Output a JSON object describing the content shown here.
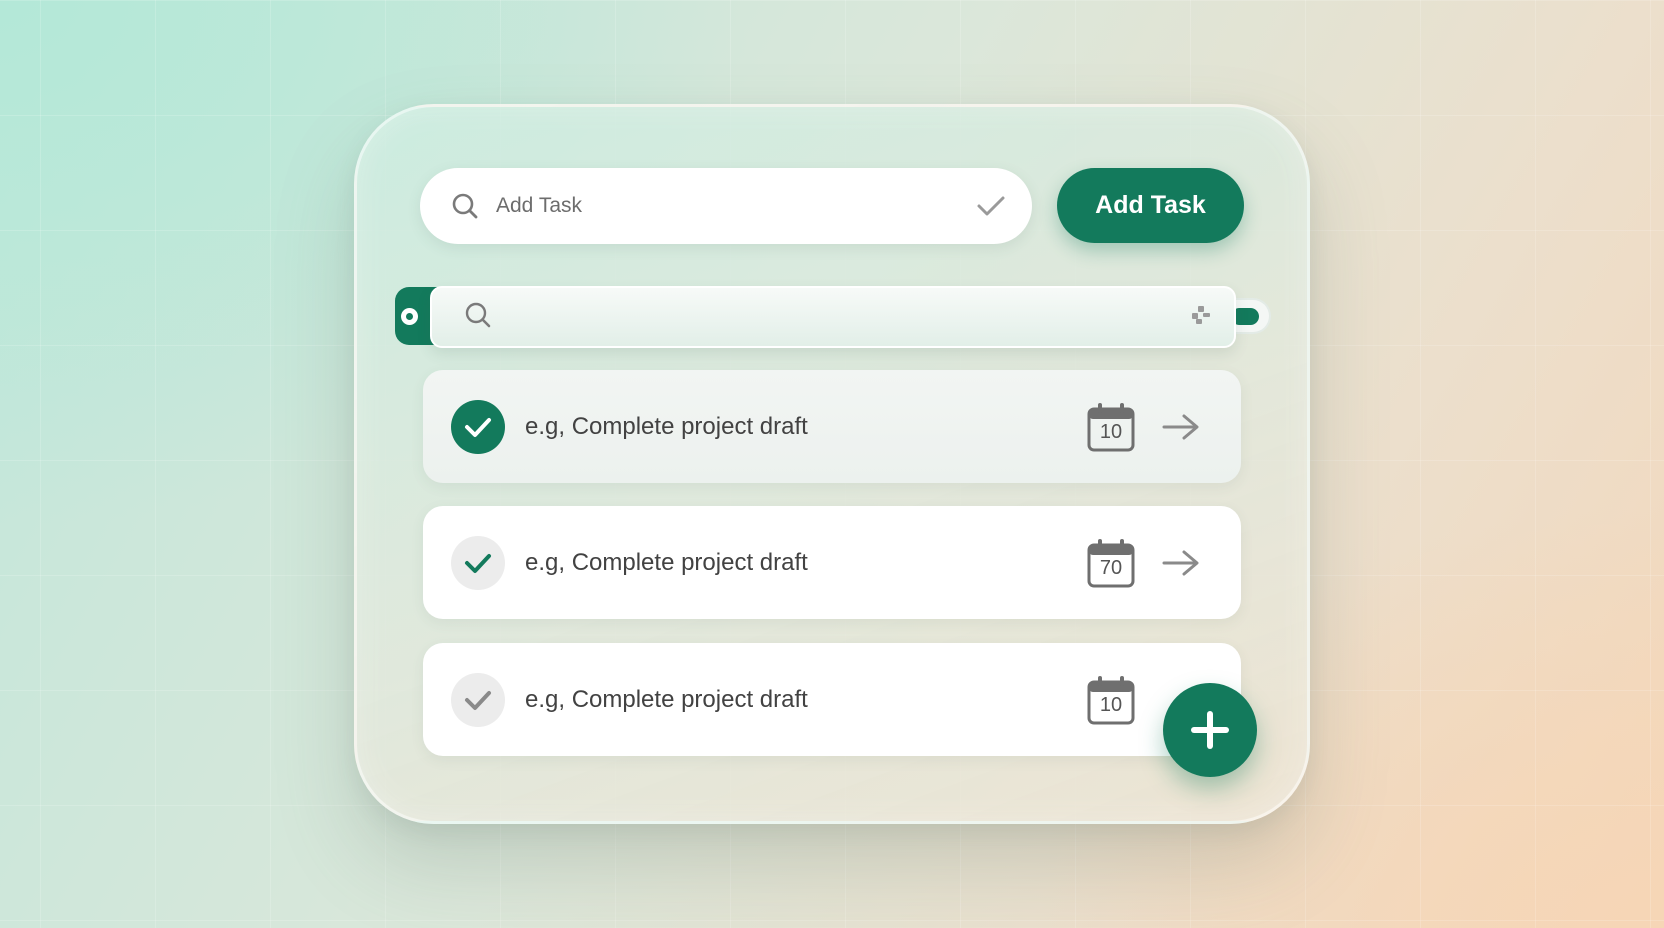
{
  "add_task": {
    "input_placeholder": "Add Task",
    "button_label": "Add Task"
  },
  "search": {
    "placeholder": ""
  },
  "tasks": [
    {
      "label": "e.g, Complete project draft",
      "date": "10",
      "state": "completed-primary"
    },
    {
      "label": "e.g, Complete project draft",
      "date": "70",
      "state": "completed"
    },
    {
      "label": "e.g, Complete project draft",
      "date": "10",
      "state": "pending"
    }
  ],
  "icons": {
    "search": "search-icon",
    "confirm": "checkmark-icon",
    "calendar": "calendar-icon",
    "next": "arrow-right-icon",
    "add": "plus-icon",
    "drag": "drag-handle-icon"
  },
  "colors": {
    "accent": "#137a5c",
    "card_bg": "#dfece4",
    "text": "#424242",
    "muted": "#8a8a8a"
  }
}
